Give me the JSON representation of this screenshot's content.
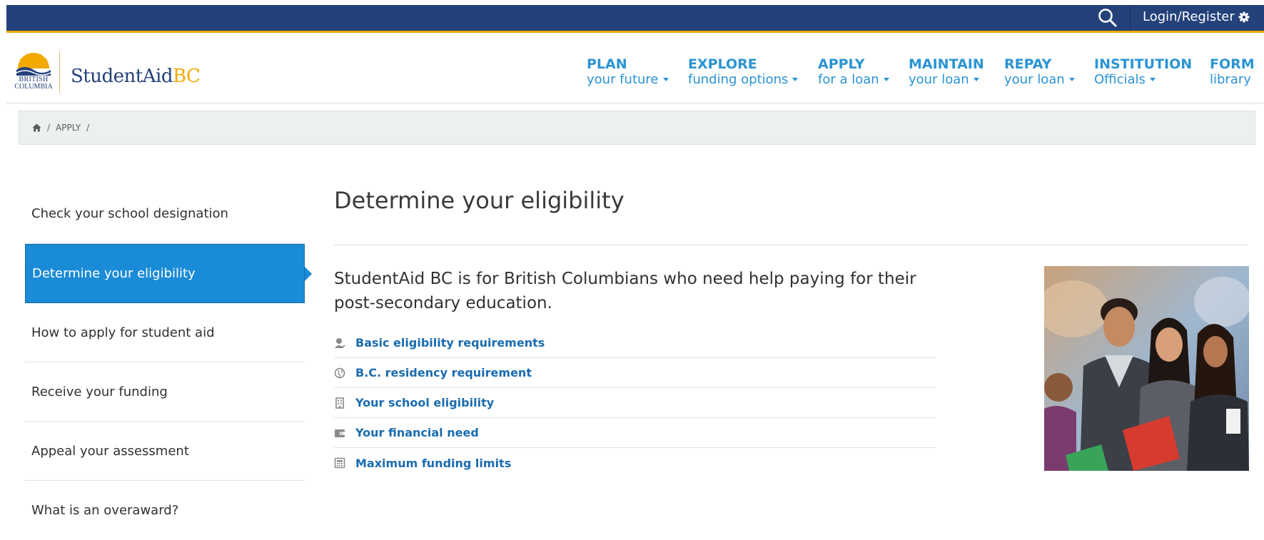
{
  "topbar": {
    "login_label": "Login/Register"
  },
  "logo": {
    "bc_line1": "BRITISH",
    "bc_line2": "COLUMBIA",
    "brand_main": "StudentAid",
    "brand_suffix": "BC"
  },
  "nav": [
    {
      "title": "PLAN",
      "subtitle": "your future",
      "has_caret": true
    },
    {
      "title": "EXPLORE",
      "subtitle": "funding options",
      "has_caret": true
    },
    {
      "title": "APPLY",
      "subtitle": "for a loan",
      "has_caret": true
    },
    {
      "title": "MAINTAIN",
      "subtitle": "your loan",
      "has_caret": true
    },
    {
      "title": "REPAY",
      "subtitle": "your loan",
      "has_caret": true
    },
    {
      "title": "INSTITUTION",
      "subtitle": "Officials",
      "has_caret": true
    },
    {
      "title": "FORM",
      "subtitle": "library",
      "has_caret": false
    }
  ],
  "breadcrumb": {
    "sep": "/",
    "items": [
      "APPLY"
    ]
  },
  "sidebar": {
    "items": [
      {
        "label": "Check your school designation",
        "active": false
      },
      {
        "label": "Determine your eligibility",
        "active": true
      },
      {
        "label": "How to apply for student aid",
        "active": false
      },
      {
        "label": "Receive your funding",
        "active": false
      },
      {
        "label": "Appeal your assessment",
        "active": false
      },
      {
        "label": "What is an overaward?",
        "active": false
      }
    ]
  },
  "main": {
    "title": "Determine your eligibility",
    "lead": "StudentAid BC is for British Columbians who need help paying for their post-secondary education.",
    "links": [
      {
        "label": "Basic eligibility requirements",
        "icon": "user-check-icon"
      },
      {
        "label": "B.C. residency requirement",
        "icon": "globe-icon"
      },
      {
        "label": "Your school eligibility",
        "icon": "building-icon"
      },
      {
        "label": "Your financial need",
        "icon": "wallet-icon"
      },
      {
        "label": "Maximum funding limits",
        "icon": "calculator-icon"
      }
    ]
  },
  "colors": {
    "topbar": "#24417a",
    "accent": "#f2a900",
    "nav": "#2b94d4",
    "active": "#1a8bd6",
    "link": "#1a6cb0"
  }
}
